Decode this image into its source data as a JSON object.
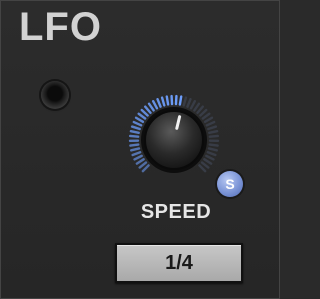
{
  "module": {
    "title": "LFO",
    "speed_label": "SPEED",
    "speed_value": "1/4",
    "sync_badge": "S",
    "knob_level": 0.55,
    "accent_color": "#6fa0ff"
  },
  "icons": {
    "led": "led-indicator-icon",
    "knob": "rotary-knob-icon",
    "badge": "sync-badge-icon"
  }
}
